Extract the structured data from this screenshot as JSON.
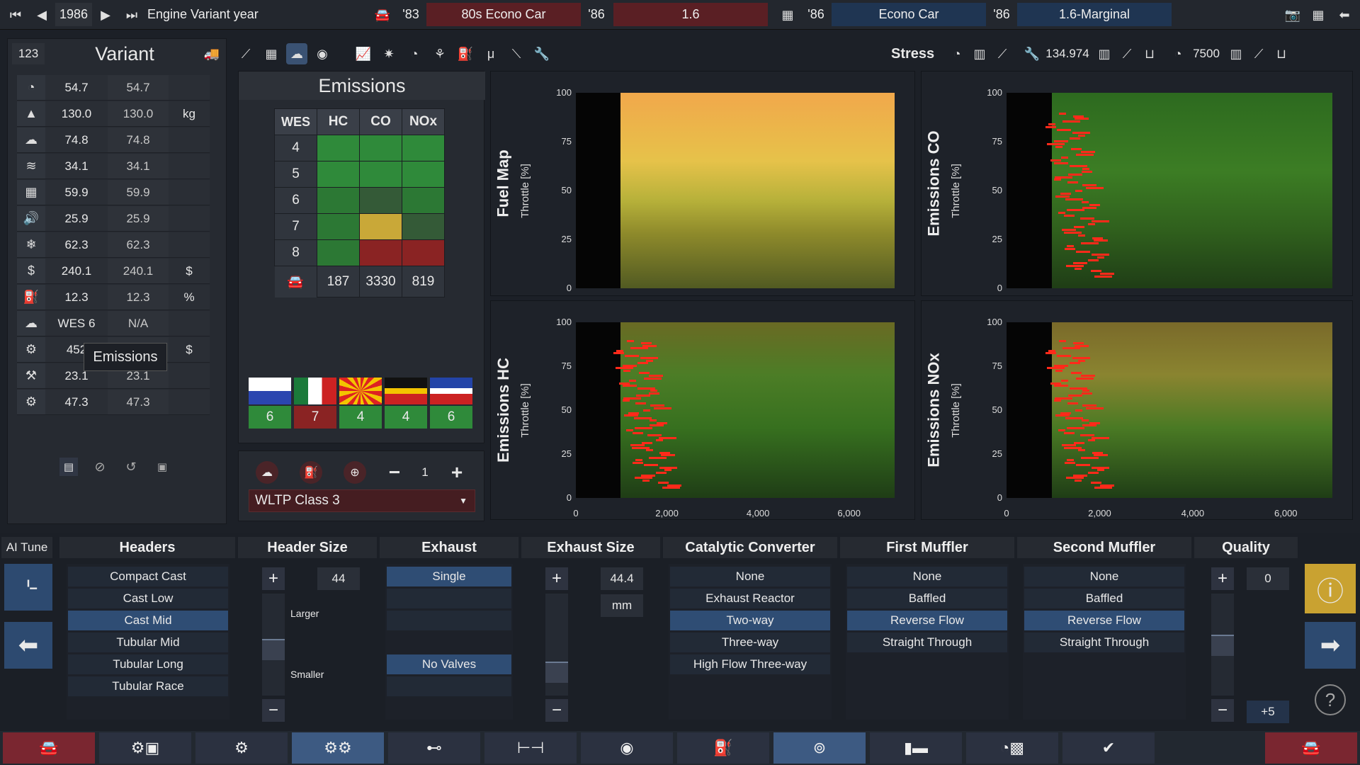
{
  "topbar": {
    "year": "1986",
    "variant_label": "Engine Variant year",
    "family_year": "'83",
    "family_name": "80s Econo Car",
    "variant_year": "'86",
    "variant_name": "1.6",
    "model_year": "'86",
    "model_name": "Econo Car",
    "trim_year": "'86",
    "trim_name": "1.6-Marginal"
  },
  "left": {
    "counter": "123",
    "title": "Variant",
    "tooltip": "Emissions",
    "stats": [
      {
        "icon": "performance-icon",
        "v1": "54.7",
        "v2": "54.7",
        "u": ""
      },
      {
        "icon": "weight-icon",
        "v1": "130.0",
        "v2": "130.0",
        "u": "kg"
      },
      {
        "icon": "drivability-icon",
        "v1": "74.8",
        "v2": "74.8",
        "u": ""
      },
      {
        "icon": "smoothness-icon",
        "v1": "34.1",
        "v2": "34.1",
        "u": ""
      },
      {
        "icon": "reliability-icon",
        "v1": "59.9",
        "v2": "59.9",
        "u": ""
      },
      {
        "icon": "noise-icon",
        "v1": "25.9",
        "v2": "25.9",
        "u": ""
      },
      {
        "icon": "cooling-icon",
        "v1": "62.3",
        "v2": "62.3",
        "u": ""
      },
      {
        "icon": "cost-icon",
        "v1": "240.1",
        "v2": "240.1",
        "u": "$"
      },
      {
        "icon": "efficiency-icon",
        "v1": "12.3",
        "v2": "12.3",
        "u": "%"
      },
      {
        "icon": "emissions-icon",
        "v1": "WES 6",
        "v2": "N/A",
        "u": ""
      },
      {
        "icon": "engineering-cost-icon",
        "v1": "452",
        "v2": "",
        "u": "$"
      },
      {
        "icon": "service-icon",
        "v1": "23.1",
        "v2": "23.1",
        "u": ""
      },
      {
        "icon": "tooling-icon",
        "v1": "47.3",
        "v2": "47.3",
        "u": ""
      }
    ]
  },
  "emissions": {
    "title": "Emissions",
    "headers": [
      "WES",
      "HC",
      "CO",
      "NOx"
    ],
    "rows": [
      "4",
      "5",
      "6",
      "7",
      "8"
    ],
    "totals": [
      "187",
      "3330",
      "819"
    ],
    "flags": [
      "6",
      "7",
      "4",
      "4",
      "6"
    ],
    "test_count": "1",
    "test_cycle": "WLTP Class 3"
  },
  "topright": {
    "stress_label": "Stress",
    "stress_value": "134.974",
    "rpm_value": "7500"
  },
  "plots": [
    {
      "title": "Fuel Map",
      "ylabel": "Throttle [%]"
    },
    {
      "title": "Emissions CO",
      "ylabel": "Throttle [%]"
    },
    {
      "title": "Emissions HC",
      "ylabel": "Throttle [%]"
    },
    {
      "title": "Emissions NOx",
      "ylabel": "Throttle [%]"
    }
  ],
  "plot_axes": {
    "yticks": [
      "100",
      "75",
      "50",
      "25",
      "0"
    ],
    "xticks": [
      "0",
      "2,000",
      "4,000",
      "6,000"
    ]
  },
  "bottom": {
    "ai_tune": "AI Tune",
    "headers": {
      "title": "Headers",
      "options": [
        "Compact Cast",
        "Cast Low",
        "Cast Mid",
        "Tubular Mid",
        "Tubular Long",
        "Tubular Race"
      ],
      "selected": 2
    },
    "header_size": {
      "title": "Header Size",
      "value": "44",
      "larger": "Larger",
      "smaller": "Smaller"
    },
    "exhaust": {
      "title": "Exhaust",
      "options": [
        "Single",
        "No Valves"
      ]
    },
    "exhaust_size": {
      "title": "Exhaust Size",
      "value": "44.4",
      "unit": "mm"
    },
    "catalytic": {
      "title": "Catalytic Converter",
      "options": [
        "None",
        "Exhaust Reactor",
        "Two-way",
        "Three-way",
        "High Flow Three-way"
      ],
      "selected": 2
    },
    "first_muffler": {
      "title": "First Muffler",
      "options": [
        "None",
        "Baffled",
        "Reverse Flow",
        "Straight Through"
      ],
      "selected": 2
    },
    "second_muffler": {
      "title": "Second Muffler",
      "options": [
        "None",
        "Baffled",
        "Reverse Flow",
        "Straight Through"
      ],
      "selected": 2
    },
    "quality": {
      "title": "Quality",
      "value": "0",
      "bonus": "+5"
    }
  }
}
